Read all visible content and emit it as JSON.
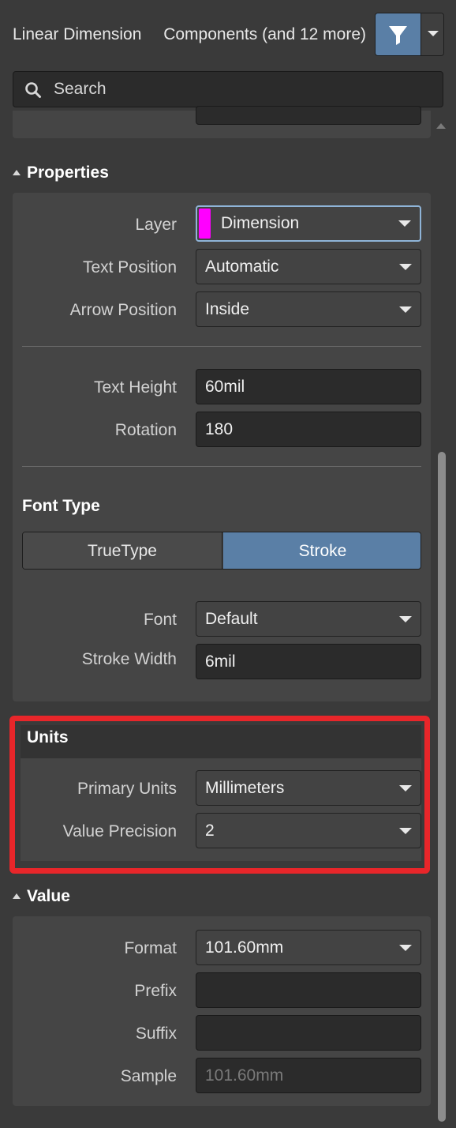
{
  "header": {
    "object_type": "Linear Dimension",
    "filter_scope": "Components (and 12 more)",
    "filter_icon": "funnel-icon",
    "dropdown_icon": "chevron-down-icon"
  },
  "search": {
    "placeholder": "Search",
    "icon": "search-icon"
  },
  "properties": {
    "title": "Properties",
    "layer": {
      "label": "Layer",
      "value": "Dimension",
      "color": "#ff00ff"
    },
    "text_position": {
      "label": "Text Position",
      "value": "Automatic"
    },
    "arrow_position": {
      "label": "Arrow Position",
      "value": "Inside"
    },
    "text_height": {
      "label": "Text Height",
      "value": "60mil"
    },
    "rotation": {
      "label": "Rotation",
      "value": "180"
    },
    "font_type": {
      "title": "Font Type",
      "options": [
        "TrueType",
        "Stroke"
      ],
      "selected": "Stroke"
    },
    "font": {
      "label": "Font",
      "value": "Default"
    },
    "stroke_width": {
      "label": "Stroke Width",
      "value": "6mil"
    }
  },
  "units": {
    "title": "Units",
    "primary_units": {
      "label": "Primary Units",
      "value": "Millimeters"
    },
    "value_precision": {
      "label": "Value Precision",
      "value": "2"
    },
    "highlight_color": "#e8262a"
  },
  "value": {
    "title": "Value",
    "format": {
      "label": "Format",
      "value": "101.60mm"
    },
    "prefix": {
      "label": "Prefix",
      "value": ""
    },
    "suffix": {
      "label": "Suffix",
      "value": ""
    },
    "sample": {
      "label": "Sample",
      "value": "101.60mm"
    }
  },
  "colors": {
    "accent": "#5a7fa6",
    "background": "#3a3a3a",
    "panel": "#454545"
  }
}
